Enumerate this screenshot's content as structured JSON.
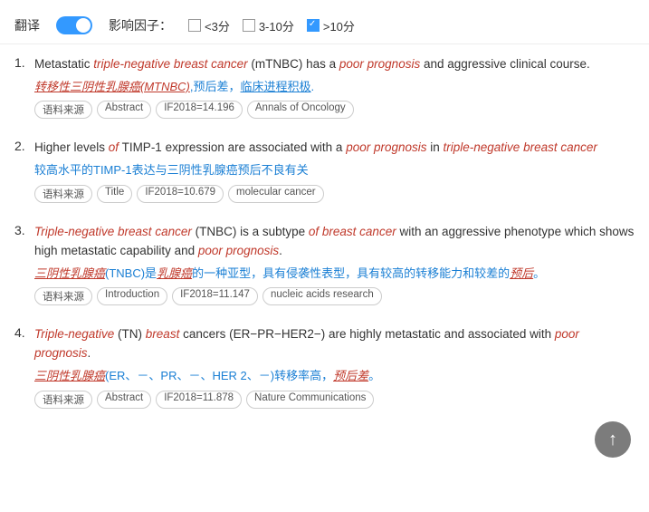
{
  "toolbar": {
    "translate_label": "翻译",
    "toggle_on": true,
    "influence_label": "影响因子：",
    "filters": [
      {
        "id": "lt3",
        "label": "<3分",
        "checked": false
      },
      {
        "id": "3to10",
        "label": "3-10分",
        "checked": false
      },
      {
        "id": "gt10",
        "label": ">10分",
        "checked": true
      }
    ]
  },
  "entries": [
    {
      "num": "1.",
      "en_parts": [
        {
          "text": "Metastatic ",
          "style": "normal"
        },
        {
          "text": "triple-negative breast cancer",
          "style": "italic-red"
        },
        {
          "text": " (mTNBC) has a ",
          "style": "normal"
        },
        {
          "text": "poor prognosis",
          "style": "italic-red"
        },
        {
          "text": " and aggressive clinical course.",
          "style": "normal"
        }
      ],
      "zh": "转移性三阴性乳腺癌(MTNBC),预后差，临床进程积极.",
      "zh_parts": [
        {
          "text": "转移性三阴性乳腺癌(MTNBC)",
          "style": "underline-red"
        },
        {
          "text": ",预后差，",
          "style": "blue"
        },
        {
          "text": "临床进程积极",
          "style": "underline-blue"
        },
        {
          "text": ".",
          "style": "blue"
        }
      ],
      "tags": [
        "语料来源",
        "Abstract",
        "IF2018=14.196",
        "Annals of Oncology"
      ]
    },
    {
      "num": "2.",
      "en_parts": [
        {
          "text": "Higher levels ",
          "style": "normal"
        },
        {
          "text": "of",
          "style": "italic-red"
        },
        {
          "text": " TIMP-1 expression are associated with a ",
          "style": "normal"
        },
        {
          "text": "poor prognosis",
          "style": "italic-red"
        },
        {
          "text": " in ",
          "style": "normal"
        },
        {
          "text": "triple-negative breast cancer",
          "style": "italic-red"
        }
      ],
      "zh_parts": [
        {
          "text": "较高水平的TIMP-1表达与三阴性乳腺癌预后不良有关",
          "style": "blue"
        }
      ],
      "tags": [
        "语料来源",
        "Title",
        "IF2018=10.679",
        "molecular cancer"
      ]
    },
    {
      "num": "3.",
      "en_parts": [
        {
          "text": "Triple-negative breast cancer",
          "style": "italic-red"
        },
        {
          "text": " (TNBC) is a subtype ",
          "style": "normal"
        },
        {
          "text": "of breast cancer",
          "style": "italic-red"
        },
        {
          "text": " with an aggressive phenotype which shows high metastatic capability and ",
          "style": "normal"
        },
        {
          "text": "poor prognosis",
          "style": "italic-red"
        },
        {
          "text": ".",
          "style": "normal"
        }
      ],
      "zh_parts": [
        {
          "text": "三阴性乳腺癌",
          "style": "underline-red"
        },
        {
          "text": "(TNBC)是",
          "style": "blue"
        },
        {
          "text": "乳腺癌",
          "style": "underline-red"
        },
        {
          "text": "的一种亚型，具有侵袭性表型，具有较高的转移能力和较差的",
          "style": "blue"
        },
        {
          "text": "预后",
          "style": "underline-red"
        },
        {
          "text": "。",
          "style": "blue"
        }
      ],
      "tags": [
        "语料来源",
        "Introduction",
        "IF2018=11.147",
        "nucleic acids research"
      ]
    },
    {
      "num": "4.",
      "en_parts": [
        {
          "text": "Triple-negative",
          "style": "italic-red"
        },
        {
          "text": " (TN) ",
          "style": "normal"
        },
        {
          "text": "breast",
          "style": "italic-red"
        },
        {
          "text": " cancers (ER−PR−HER2−) are highly metastatic and associated with ",
          "style": "normal"
        },
        {
          "text": "poor prognosis",
          "style": "italic-red"
        },
        {
          "text": ".",
          "style": "normal"
        }
      ],
      "zh_parts": [
        {
          "text": "三阴性乳腺癌",
          "style": "underline-red"
        },
        {
          "text": "(ER、－、PR、－、HER 2、－)转移率高，",
          "style": "blue"
        },
        {
          "text": "预后差",
          "style": "underline-red"
        },
        {
          "text": "。",
          "style": "blue"
        }
      ],
      "tags": [
        "语料来源",
        "Abstract",
        "IF2018=11.878",
        "Nature Communications"
      ]
    }
  ],
  "scroll_top_icon": "↑"
}
